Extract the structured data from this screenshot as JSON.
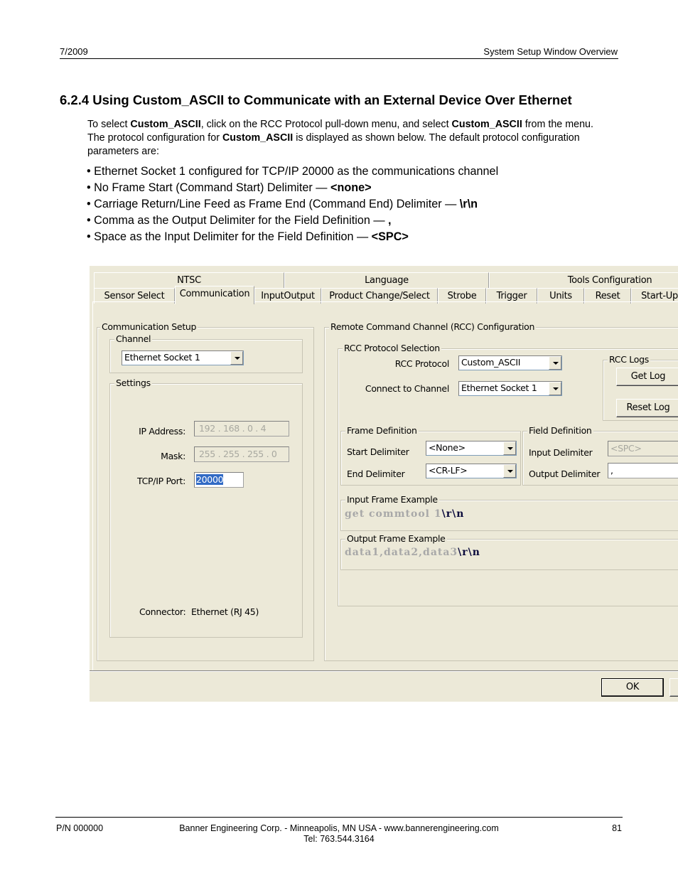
{
  "page_header": {
    "date": "7/2009",
    "section": "System Setup Window Overview"
  },
  "title": "6.2.4 Using Custom_ASCII to Communicate with an External Device Over Ethernet",
  "intro": {
    "t1": "To select ",
    "b1": "Custom_ASCII",
    "t2": ", click on the RCC Protocol pull-down menu, and select ",
    "b2": "Custom_ASCII",
    "t3": " from the menu. The protocol configuration for ",
    "b3": "Custom_ASCII",
    "t4": " is displayed as shown below. The default protocol configuration parameters are:"
  },
  "bullets": [
    {
      "text": "• Ethernet Socket 1 configured for TCP/IP 20000 as the communications channel",
      "bold": ""
    },
    {
      "text": "• No Frame Start (Command Start) Delimiter — ",
      "bold": "<none>"
    },
    {
      "text": "• Carriage Return/Line Feed as Frame End (Command End) Delimiter — ",
      "bold": "\\r\\n"
    },
    {
      "text": "• Comma as the Output Delimiter for the Field Definition — ",
      "bold": ","
    },
    {
      "text": "• Space as the Input Delimiter for the Field Definition — ",
      "bold": "<SPC>"
    }
  ],
  "window": {
    "tabs_top": [
      "NTSC",
      "Language",
      "Tools Configuration"
    ],
    "tabs_bottom": [
      "Sensor Select",
      "Communication",
      "InputOutput",
      "Product Change/Select",
      "Strobe",
      "Trigger",
      "Units",
      "Reset",
      "Start-Up"
    ],
    "active_tab": "Communication",
    "comm_setup": {
      "title": "Communication Setup",
      "channel_group": "Channel",
      "channel_value": "Ethernet Socket 1",
      "settings_group": "Settings",
      "ip_label": "IP Address:",
      "ip_value": "192 . 168 .  0  .  4",
      "mask_label": "Mask:",
      "mask_value": "255 . 255 . 255 .  0",
      "port_label": "TCP/IP Port:",
      "port_value": "20000",
      "connector_label": "Connector:",
      "connector_value": "Ethernet (RJ 45)"
    },
    "rcc": {
      "title": "Remote Command Channel (RCC) Configuration",
      "protocol_group": "RCC Protocol  Selection",
      "protocol_label": "RCC Protocol",
      "protocol_value": "Custom_ASCII",
      "channel_label": "Connect to Channel",
      "channel_value": "Ethernet Socket 1",
      "logs_group": "RCC Logs",
      "get_log": "Get Log",
      "reset_log": "Reset Log",
      "frame_group": "Frame Definition",
      "start_label": "Start Delimiter",
      "start_value": "<None>",
      "end_label": "End Delimiter",
      "end_value": "<CR-LF>",
      "field_group": "Field Definition",
      "input_label": "Input Delimiter",
      "input_value": "<SPC>",
      "output_label": "Output Delimiter",
      "output_value": ",",
      "input_example_group": "Input Frame Example",
      "input_example_text": "get commtool 1",
      "input_example_term": "\\r\\n",
      "output_example_group": "Output Frame Example",
      "output_example_text": "data1,data2,data3",
      "output_example_term": "\\r\\n"
    },
    "ok_button": "OK"
  },
  "footer": {
    "part_number": "P/N 000000",
    "company": "Banner Engineering Corp. - Minneapolis, MN USA - www.bannerengineering.com",
    "tel": "Tel: 763.544.3164",
    "page": "81"
  }
}
